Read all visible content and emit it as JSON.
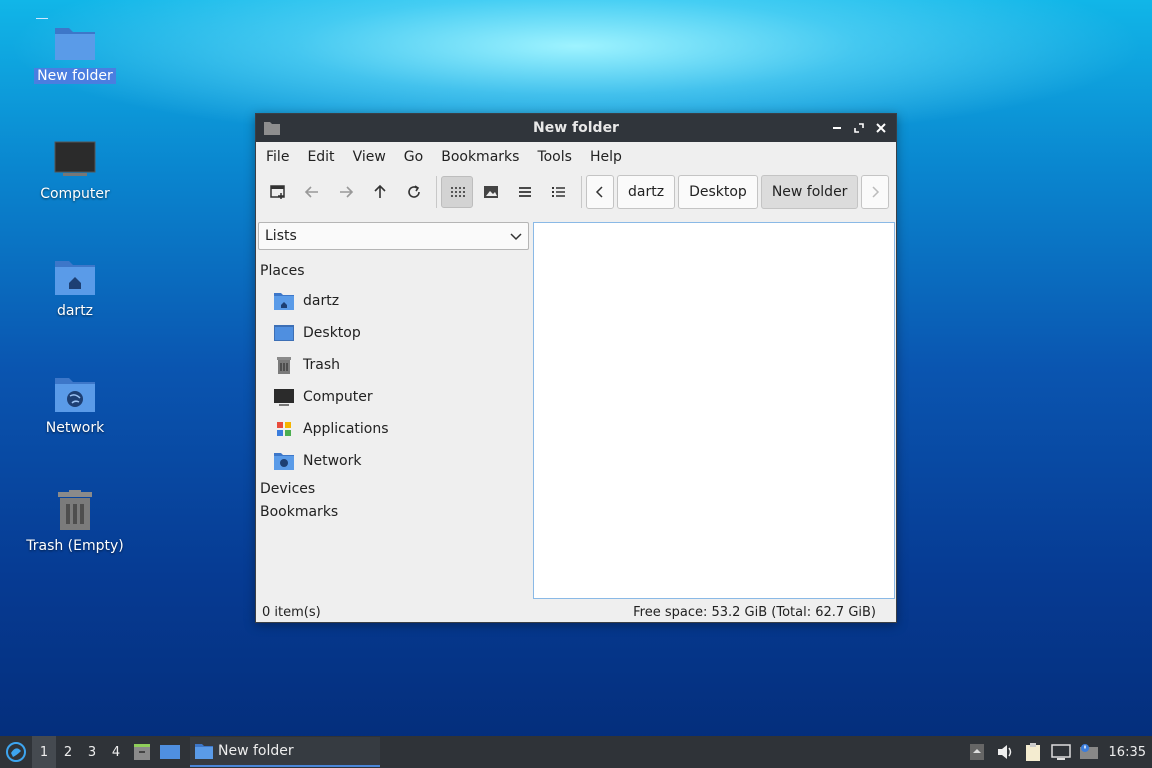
{
  "desktop": {
    "icons": [
      {
        "label": "New folder",
        "icon": "folder-icon"
      },
      {
        "label": "Computer",
        "icon": "computer-icon"
      },
      {
        "label": "dartz",
        "icon": "home-folder-icon"
      },
      {
        "label": "Network",
        "icon": "network-folder-icon"
      },
      {
        "label": "Trash (Empty)",
        "icon": "trash-icon"
      }
    ]
  },
  "window": {
    "title": "New folder",
    "menu": [
      "File",
      "Edit",
      "View",
      "Go",
      "Bookmarks",
      "Tools",
      "Help"
    ],
    "breadcrumbs": [
      "dartz",
      "Desktop",
      "New folder"
    ],
    "sidebar": {
      "mode": "Lists",
      "places_header": "Places",
      "places": [
        {
          "label": "dartz",
          "icon": "home-folder-icon"
        },
        {
          "label": "Desktop",
          "icon": "desktop-icon"
        },
        {
          "label": "Trash",
          "icon": "trash-icon"
        },
        {
          "label": "Computer",
          "icon": "computer-icon"
        },
        {
          "label": "Applications",
          "icon": "applications-icon"
        },
        {
          "label": "Network",
          "icon": "network-folder-icon"
        }
      ],
      "devices_header": "Devices",
      "bookmarks_header": "Bookmarks"
    },
    "status": {
      "items": "0 item(s)",
      "free_space": "Free space: 53.2 GiB (Total: 62.7 GiB)"
    }
  },
  "taskbar": {
    "workspaces": [
      "1",
      "2",
      "3",
      "4"
    ],
    "active_workspace": "1",
    "task_label": "New folder",
    "clock": "16:35"
  },
  "colors": {
    "accent": "#4a86d9",
    "folder": "#4f8fe0",
    "titlebar": "#30353b",
    "taskbar": "#2f3338"
  }
}
